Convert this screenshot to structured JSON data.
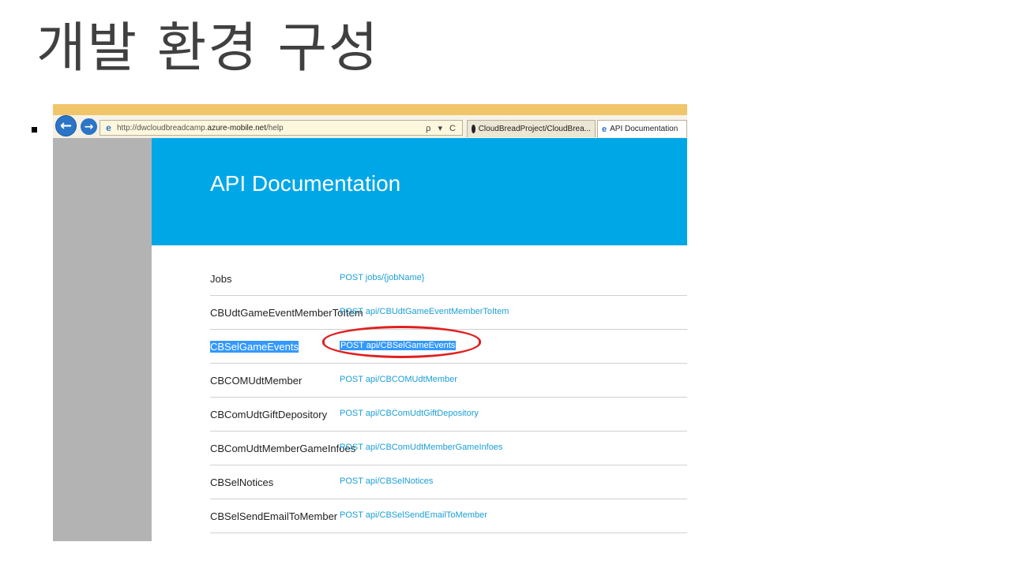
{
  "slide": {
    "title": "개발 환경 구성"
  },
  "browser": {
    "address_prefix": "http://dwcloudbreadcamp.",
    "address_domain": "azure-mobile.net",
    "address_suffix": "/help",
    "address_tools": "ρ ▾ C",
    "tabs": [
      {
        "label": "CloudBreadProject/CloudBrea...",
        "icon": "github-icon"
      },
      {
        "label": "API Documentation",
        "icon": "ie-icon"
      }
    ],
    "back_glyph": "←",
    "forward_glyph": "→"
  },
  "page": {
    "banner_title": "API Documentation",
    "apis": [
      {
        "name": "Jobs",
        "link": "POST jobs/{jobName}"
      },
      {
        "name": "CBUdtGameEventMemberToItem",
        "link": "POST api/CBUdtGameEventMemberToItem"
      },
      {
        "name": "CBSelGameEvents",
        "link": "POST api/CBSelGameEvents",
        "selected": true
      },
      {
        "name": "CBCOMUdtMember",
        "link": "POST api/CBCOMUdtMember"
      },
      {
        "name": "CBComUdtGiftDepository",
        "link": "POST api/CBComUdtGiftDepository"
      },
      {
        "name": "CBComUdtMemberGameInfoes",
        "link": "POST api/CBComUdtMemberGameInfoes"
      },
      {
        "name": "CBSelNotices",
        "link": "POST api/CBSelNotices"
      },
      {
        "name": "CBSelSendEmailToMember",
        "link": "POST api/CBSelSendEmailToMember"
      }
    ]
  },
  "colors": {
    "banner": "#00a7e6",
    "link": "#1b9fd6",
    "selection": "#3399ff",
    "annotation": "#e02020"
  }
}
